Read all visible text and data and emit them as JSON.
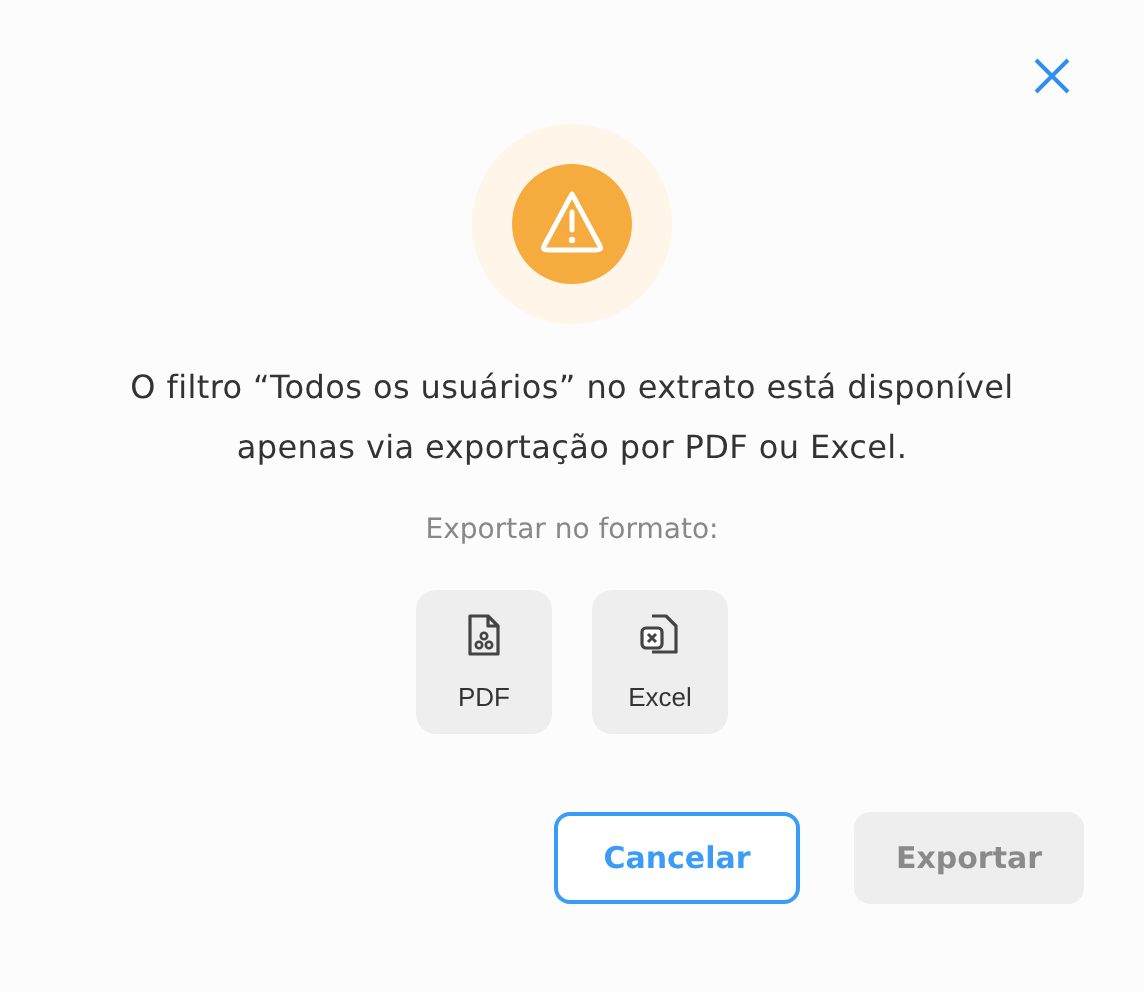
{
  "message": "O filtro “Todos os usuários” no extrato está disponível apenas via exportação por PDF ou Excel.",
  "format_prompt": "Exportar no formato:",
  "formats": [
    {
      "kind": "pdf",
      "label": "PDF",
      "selected": false
    },
    {
      "kind": "excel",
      "label": "Excel",
      "selected": false
    }
  ],
  "buttons": [
    {
      "kind": "secondary",
      "label": "Cancelar",
      "disabled": false
    },
    {
      "kind": "primary",
      "label": "Exportar",
      "disabled": true
    }
  ]
}
